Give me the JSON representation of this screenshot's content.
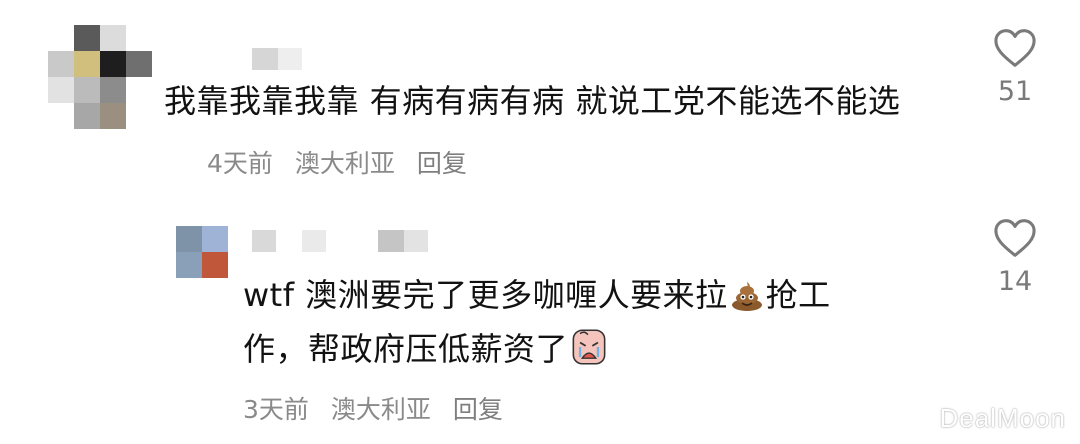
{
  "comment1": {
    "text": "我靠我靠我靠 有病有病有病 就说工党不能选不能选",
    "time": "4天前",
    "location": "澳大利亚",
    "reply_label": "回复",
    "like_count": "51",
    "avatar_colors": [
      "#ffffff",
      "#5a5a5a",
      "#dcdcdc",
      "#ffffff",
      "#c9c9c9",
      "#d1bf7d",
      "#1e1e1e",
      "#6f6f6f",
      "#e2e2e2",
      "#bbbbbb",
      "#8c8c8c",
      "#ffffff",
      "#ffffff",
      "#a7a7a7",
      "#9b8f80",
      "#ffffff"
    ]
  },
  "reply1": {
    "text_part1": "wtf 澳洲要完了更多咖喱人要来拉",
    "text_part2": "抢工作，帮政府压低薪资了",
    "emoji1": "poop-emoji",
    "emoji2": "crying-face-emoji",
    "time": "3天前",
    "location": "澳大利亚",
    "reply_label": "回复",
    "like_count": "14",
    "avatar_colors": [
      "#7f93a8",
      "#9fb3d6",
      "#8aa0b8",
      "#c0573a"
    ]
  },
  "watermark": "DealMoon",
  "icons": {
    "like": "heart-outline-icon"
  },
  "colors": {
    "text": "#121212",
    "meta": "#8a8a8a",
    "heart_stroke": "#7a7a7a"
  }
}
